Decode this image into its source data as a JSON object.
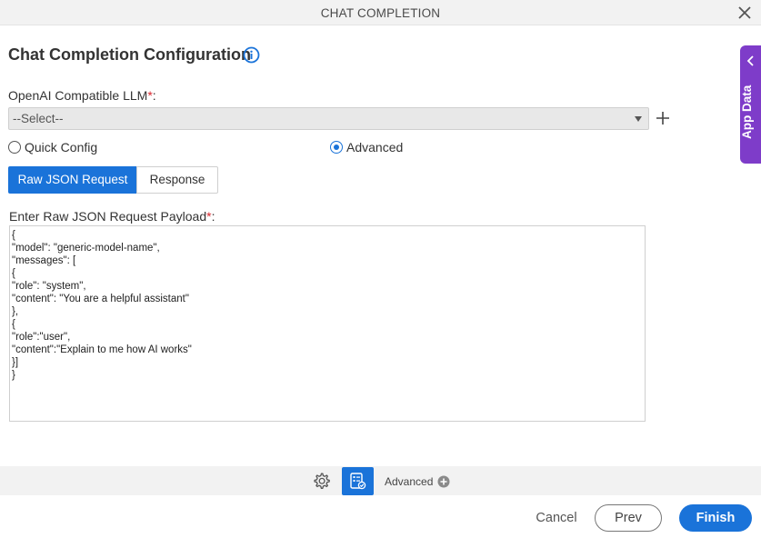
{
  "dialog": {
    "title": "CHAT COMPLETION",
    "heading": "Chat Completion Configuration"
  },
  "side_tab": {
    "label": "App Data"
  },
  "llm": {
    "label": "OpenAI Compatible LLM",
    "required_mark": "*",
    "suffix": ":",
    "selected": "--Select--"
  },
  "mode": {
    "options": [
      {
        "label": "Quick Config",
        "checked": false
      },
      {
        "label": "Advanced",
        "checked": true
      }
    ]
  },
  "tabs": [
    {
      "label": "Raw JSON Request",
      "active": true
    },
    {
      "label": "Response",
      "active": false
    }
  ],
  "payload": {
    "label": "Enter Raw JSON Request Payload",
    "required_mark": "*",
    "suffix": ":",
    "lines": [
      "{",
      "\"model\": \"generic-model-name\",",
      "\"messages\": [",
      "{",
      "\"role\": \"system\",",
      "\"content\": \"You are a helpful assistant\"",
      "},",
      "{",
      "\"role\":\"user\",",
      "\"content\":\"Explain to me how AI works\"",
      "}]",
      "}"
    ]
  },
  "footer_toolbar": {
    "advanced_label": "Advanced"
  },
  "actions": {
    "cancel": "Cancel",
    "prev": "Prev",
    "finish": "Finish"
  },
  "colors": {
    "accent": "#1a73d9",
    "side_tab": "#7e3cc9",
    "required": "#d9262d"
  },
  "icons": [
    "close-icon",
    "info-icon",
    "chevron-left-icon",
    "plus-icon",
    "gear-icon",
    "form-settings-icon",
    "plus-circle-icon"
  ]
}
